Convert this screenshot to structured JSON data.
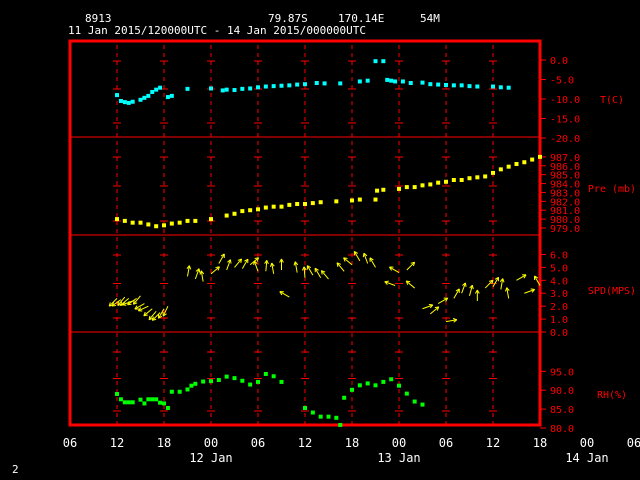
{
  "header": {
    "station": "8913",
    "lat": "79.87S",
    "lon": "170.14E",
    "elev": "54M",
    "period": "11 Jan 2015/120000UTC - 14 Jan 2015/000000UTC"
  },
  "footer": {
    "page_number": "2"
  },
  "chart_data": {
    "type": "scatter",
    "x_axis": {
      "range_hours": [
        -6,
        54
      ],
      "tick_labels": [
        "06",
        "12",
        "18",
        "00",
        "06",
        "12",
        "18",
        "00",
        "06",
        "12",
        "18",
        "00",
        "06"
      ],
      "date_labels": [
        "12 Jan",
        "13 Jan",
        "14 Jan"
      ]
    },
    "panels": [
      {
        "name": "temperature",
        "ylabel": "T(C)",
        "ylim": [
          -20.0,
          0.0
        ],
        "ticks": [
          "0.0",
          "-5.0",
          "-10.0",
          "-15.0",
          "-20.0"
        ],
        "color": "#00ffff",
        "points": [
          [
            0,
            -9
          ],
          [
            0.5,
            -10.5
          ],
          [
            1,
            -10.8
          ],
          [
            1.5,
            -11
          ],
          [
            2,
            -10.7
          ],
          [
            3,
            -10.2
          ],
          [
            3.5,
            -9.7
          ],
          [
            4,
            -9.2
          ],
          [
            4.5,
            -8.2
          ],
          [
            5,
            -7.6
          ],
          [
            5.5,
            -7.1
          ],
          [
            6.5,
            -9.5
          ],
          [
            7,
            -9.2
          ],
          [
            9,
            -7.4
          ],
          [
            12,
            -7.3
          ],
          [
            13.5,
            -7.8
          ],
          [
            14,
            -7.6
          ],
          [
            15,
            -7.7
          ],
          [
            16,
            -7.4
          ],
          [
            17,
            -7.3
          ],
          [
            18,
            -7.0
          ],
          [
            19,
            -6.8
          ],
          [
            20,
            -6.7
          ],
          [
            21,
            -6.6
          ],
          [
            22,
            -6.5
          ],
          [
            23,
            -6.3
          ],
          [
            24,
            -6.2
          ],
          [
            25.5,
            -5.9
          ],
          [
            26.5,
            -6.0
          ],
          [
            28.5,
            -6.0
          ],
          [
            31,
            -5.5
          ],
          [
            32,
            -5.3
          ],
          [
            33,
            -0.3
          ],
          [
            34,
            -0.3
          ],
          [
            34.5,
            -5.1
          ],
          [
            35,
            -5.3
          ],
          [
            35.5,
            -5.5
          ],
          [
            36.5,
            -5.5
          ],
          [
            37.5,
            -5.9
          ],
          [
            39,
            -5.8
          ],
          [
            40,
            -6.2
          ],
          [
            41,
            -6.3
          ],
          [
            42,
            -6.4
          ],
          [
            43,
            -6.5
          ],
          [
            44,
            -6.5
          ],
          [
            45,
            -6.7
          ],
          [
            46,
            -6.8
          ],
          [
            48,
            -6.8
          ],
          [
            49,
            -7.0
          ],
          [
            50,
            -7.1
          ]
        ]
      },
      {
        "name": "pressure",
        "ylabel": "Pre (mb)",
        "ylim": [
          979.0,
          988.0
        ],
        "ticks": [
          "987.0",
          "986.0",
          "985.0",
          "984.0",
          "983.0",
          "982.0",
          "981.0",
          "980.0",
          "979.0"
        ],
        "color": "#ffff00",
        "points": [
          [
            0,
            980.0
          ],
          [
            1,
            979.8
          ],
          [
            2,
            979.6
          ],
          [
            3,
            979.6
          ],
          [
            4,
            979.4
          ],
          [
            5,
            979.2
          ],
          [
            6,
            979.3
          ],
          [
            7,
            979.5
          ],
          [
            8,
            979.6
          ],
          [
            9,
            979.8
          ],
          [
            10,
            979.8
          ],
          [
            12,
            980.0
          ],
          [
            14,
            980.4
          ],
          [
            15,
            980.6
          ],
          [
            16,
            980.9
          ],
          [
            17,
            981.0
          ],
          [
            18,
            981.1
          ],
          [
            19,
            981.3
          ],
          [
            20,
            981.4
          ],
          [
            21,
            981.4
          ],
          [
            22,
            981.6
          ],
          [
            23,
            981.7
          ],
          [
            24,
            981.7
          ],
          [
            25,
            981.8
          ],
          [
            26,
            981.9
          ],
          [
            28,
            982.0
          ],
          [
            30,
            982.1
          ],
          [
            31,
            982.2
          ],
          [
            33,
            982.2
          ],
          [
            33.2,
            983.2
          ],
          [
            34,
            983.3
          ],
          [
            36,
            983.4
          ],
          [
            37,
            983.6
          ],
          [
            38,
            983.6
          ],
          [
            39,
            983.8
          ],
          [
            40,
            983.9
          ],
          [
            41,
            984.1
          ],
          [
            42,
            984.2
          ],
          [
            43,
            984.4
          ],
          [
            44,
            984.4
          ],
          [
            45,
            984.6
          ],
          [
            46,
            984.7
          ],
          [
            47,
            984.8
          ],
          [
            48,
            985.2
          ],
          [
            49,
            985.6
          ],
          [
            50,
            985.9
          ],
          [
            51,
            986.2
          ],
          [
            52,
            986.4
          ],
          [
            53,
            986.7
          ],
          [
            54,
            987.0
          ]
        ]
      },
      {
        "name": "wind",
        "ylabel": "SPD(MPS)",
        "ylim": [
          0.0,
          6.5
        ],
        "ticks": [
          "6.0",
          "5.0",
          "4.0",
          "3.0",
          "2.0",
          "1.0",
          "0.0"
        ],
        "color": "#ffff00",
        "points": [
          [
            0,
            2.6,
            225
          ],
          [
            0.5,
            2.5,
            215
          ],
          [
            1,
            2.7,
            230
          ],
          [
            1.5,
            2.6,
            220
          ],
          [
            2,
            2.4,
            200
          ],
          [
            2.5,
            2.6,
            215
          ],
          [
            3,
            2.8,
            230
          ],
          [
            3.5,
            2.2,
            210
          ],
          [
            4,
            2.0,
            205
          ],
          [
            4.5,
            1.8,
            220
          ],
          [
            5,
            1.6,
            230
          ],
          [
            5.5,
            1.5,
            225
          ],
          [
            6,
            1.8,
            240
          ],
          [
            6.5,
            2.0,
            245
          ],
          [
            9,
            4.3,
            80
          ],
          [
            10,
            4.1,
            70
          ],
          [
            11,
            3.9,
            100
          ],
          [
            12,
            4.5,
            40
          ],
          [
            13,
            5.3,
            60
          ],
          [
            14,
            4.8,
            70
          ],
          [
            15,
            5.0,
            50
          ],
          [
            16,
            4.9,
            60
          ],
          [
            17,
            5.2,
            40
          ],
          [
            18,
            4.7,
            110
          ],
          [
            19,
            4.7,
            85
          ],
          [
            20,
            4.5,
            100
          ],
          [
            21,
            4.8,
            90
          ],
          [
            22,
            2.7,
            150
          ],
          [
            23,
            4.6,
            100
          ],
          [
            24,
            4.2,
            95
          ],
          [
            25,
            4.4,
            120
          ],
          [
            26,
            4.2,
            120
          ],
          [
            27,
            4.1,
            130
          ],
          [
            29,
            4.7,
            130
          ],
          [
            30,
            5.2,
            140
          ],
          [
            31,
            5.5,
            120
          ],
          [
            32,
            5.3,
            110
          ],
          [
            33,
            5.0,
            120
          ],
          [
            35.5,
            3.6,
            160
          ],
          [
            36,
            4.6,
            150
          ],
          [
            37,
            4.8,
            45
          ],
          [
            38,
            3.4,
            140
          ],
          [
            39,
            1.8,
            20
          ],
          [
            40,
            1.4,
            40
          ],
          [
            41,
            2.2,
            30
          ],
          [
            42,
            0.8,
            10
          ],
          [
            43,
            2.6,
            60
          ],
          [
            44,
            3.0,
            70
          ],
          [
            45,
            2.8,
            75
          ],
          [
            46,
            2.4,
            90
          ],
          [
            47,
            3.4,
            45
          ],
          [
            48,
            3.5,
            60
          ],
          [
            49,
            3.3,
            80
          ],
          [
            50,
            2.6,
            100
          ],
          [
            51,
            4.0,
            30
          ],
          [
            52,
            3.0,
            20
          ],
          [
            54,
            3.6,
            120
          ]
        ]
      },
      {
        "name": "humidity",
        "ylabel": "RH(%)",
        "ylim": [
          80.0,
          98.0
        ],
        "ticks": [
          "95.0",
          "90.0",
          "85.0",
          "80.0"
        ],
        "color": "#00ff00",
        "points": [
          [
            0,
            89
          ],
          [
            0.5,
            87.6
          ],
          [
            1,
            86.8
          ],
          [
            1.5,
            86.8
          ],
          [
            2,
            86.8
          ],
          [
            3,
            87.5
          ],
          [
            3.5,
            86.5
          ],
          [
            4,
            87.6
          ],
          [
            4.5,
            87.6
          ],
          [
            5,
            87.6
          ],
          [
            5.5,
            86.7
          ],
          [
            6,
            86.5
          ],
          [
            6.5,
            85.3
          ],
          [
            7,
            89.6
          ],
          [
            8,
            89.6
          ],
          [
            9,
            90.2
          ],
          [
            9.5,
            91.2
          ],
          [
            10,
            91.7
          ],
          [
            11,
            92.3
          ],
          [
            12,
            92.4
          ],
          [
            13,
            92.7
          ],
          [
            14,
            93.6
          ],
          [
            15,
            93.2
          ],
          [
            16,
            92.5
          ],
          [
            17,
            91.5
          ],
          [
            18,
            92.2
          ],
          [
            19,
            94.3
          ],
          [
            20,
            93.7
          ],
          [
            21,
            92.2
          ],
          [
            24,
            85.3
          ],
          [
            25,
            84.1
          ],
          [
            26,
            83.0
          ],
          [
            27,
            83.0
          ],
          [
            28,
            82.7
          ],
          [
            28.5,
            80.8
          ],
          [
            29,
            88.0
          ],
          [
            30,
            90.1
          ],
          [
            31,
            91.3
          ],
          [
            32,
            91.8
          ],
          [
            33,
            91.3
          ],
          [
            34,
            92.2
          ],
          [
            35,
            92.9
          ],
          [
            36,
            91.2
          ],
          [
            37,
            89.1
          ],
          [
            38,
            87.0
          ],
          [
            39,
            86.2
          ]
        ]
      }
    ]
  }
}
